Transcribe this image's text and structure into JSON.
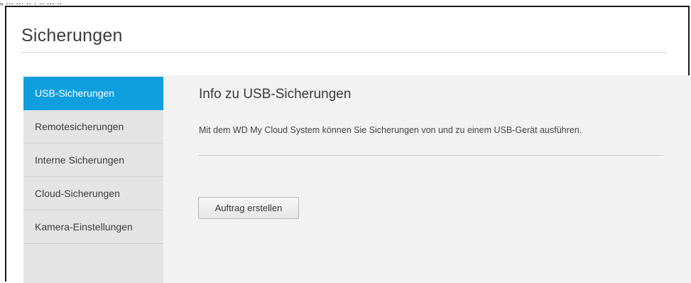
{
  "page": {
    "title": "Sicherungen"
  },
  "sidebar": {
    "items": [
      {
        "label": "USB-Sicherungen",
        "active": true
      },
      {
        "label": "Remotesicherungen",
        "active": false
      },
      {
        "label": "Interne Sicherungen",
        "active": false
      },
      {
        "label": "Cloud-Sicherungen",
        "active": false
      },
      {
        "label": "Kamera-Einstellungen",
        "active": false
      }
    ]
  },
  "content": {
    "heading": "Info zu USB-Sicherungen",
    "description": "Mit dem WD My Cloud System können Sie Sicherungen von und zu einem USB-Gerät ausführen.",
    "create_button_label": "Auftrag erstellen"
  },
  "colors": {
    "accent": "#0f9fdf",
    "sidebar_bg": "#e4e4e4",
    "panel_bg": "#f2f2f2"
  }
}
